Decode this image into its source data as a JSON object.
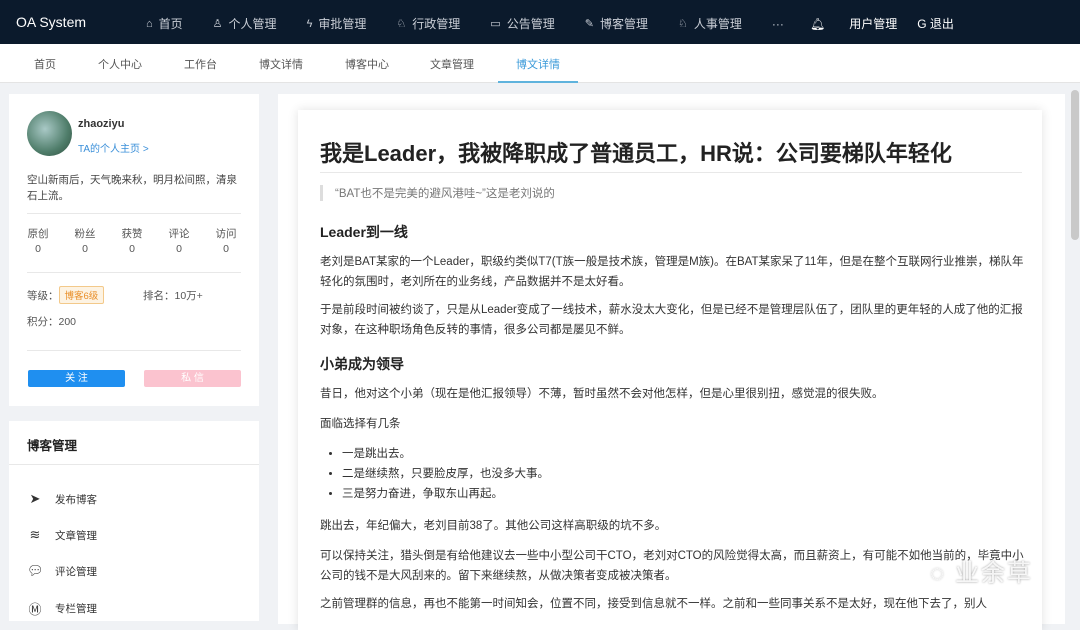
{
  "header": {
    "brand": "OA System",
    "nav": [
      {
        "icon": "home-icon",
        "g": "⌂",
        "label": "首页"
      },
      {
        "icon": "user-icon",
        "g": "♙",
        "label": "个人管理"
      },
      {
        "icon": "approve-icon",
        "g": "ϟ",
        "label": "审批管理"
      },
      {
        "icon": "admin-icon",
        "g": "♘",
        "label": "行政管理"
      },
      {
        "icon": "notice-icon",
        "g": "▭",
        "label": "公告管理"
      },
      {
        "icon": "blog-edit-icon",
        "g": "✎",
        "label": "博客管理"
      },
      {
        "icon": "hr-icon",
        "g": "♘",
        "label": "人事管理"
      }
    ],
    "more": "···",
    "user": "用户管理",
    "logout": "退出"
  },
  "tabs": [
    "首页",
    "个人中心",
    "工作台",
    "博文详情",
    "博客中心",
    "文章管理",
    "博文详情"
  ],
  "profile": {
    "name": "zhaoziyu",
    "link": "TA的个人主页 >",
    "bio": "空山新雨后，天气晚来秋，明月松间照，清泉石上流。",
    "stats": [
      {
        "label": "原创",
        "value": "0"
      },
      {
        "label": "粉丝",
        "value": "0"
      },
      {
        "label": "获赞",
        "value": "0"
      },
      {
        "label": "评论",
        "value": "0"
      },
      {
        "label": "访问",
        "value": "0"
      }
    ],
    "level_label": "等级：",
    "level": "博客6级",
    "rank_label": "排名：",
    "rank": "10万+",
    "points_label": "积分：",
    "points": "200",
    "follow": "关 注",
    "message": "私 信",
    "follow_color": "#1f8ff0",
    "message_color": "#fbc3cf"
  },
  "blog_mgmt": {
    "title": "博客管理",
    "items": [
      "发布博客",
      "文章管理",
      "评论管理",
      "专栏管理"
    ]
  },
  "article": {
    "title": "我是Leader，我被降职成了普通员工，HR说：公司要梯队年轻化",
    "quote": "“BAT也不是完美的避风港哇~”这是老刘说的",
    "h1": "Leader到一线",
    "p1": "老刘是BAT某家的一个Leader，职级约类似T7(T族一般是技术族，管理是M族)。在BAT某家呆了11年，但是在整个互联网行业推崇，梯队年轻化的氛围时，老刘所在的业务线，产品数据并不是太好看。",
    "p2": "于是前段时间被约谈了，只是从Leader变成了一线技术，薪水没太大变化，但是已经不是管理层队伍了，团队里的更年轻的人成了他的汇报对象，在这种职场角色反转的事情，很多公司都是屡见不鲜。",
    "h2": "小弟成为领导",
    "p3": "昔日，他对这个小弟（现在是他汇报领导）不薄，暂时虽然不会对他怎样，但是心里很别扭，感觉混的很失败。",
    "p4": "面临选择有几条",
    "list": [
      "一是跳出去。",
      "二是继续熬，只要脸皮厚，也没多大事。",
      "三是努力奋进，争取东山再起。"
    ],
    "p5": "跳出去，年纪偏大，老刘目前38了。其他公司这样高职级的坑不多。",
    "p6": "可以保持关注，猎头倒是有给他建议去一些中小型公司干CTO，老刘对CTO的风险觉得太高，而且薪资上，有可能不如他当前的，毕竟中小公司的钱不是大风刮来的。留下来继续熬，从做决策者变成被决策者。",
    "p7": "之前管理群的信息，再也不能第一时间知会，位置不同，接受到信息就不一样。之前和一些同事关系不是太好，现在他下去了，别人"
  },
  "watermark": "业余草"
}
